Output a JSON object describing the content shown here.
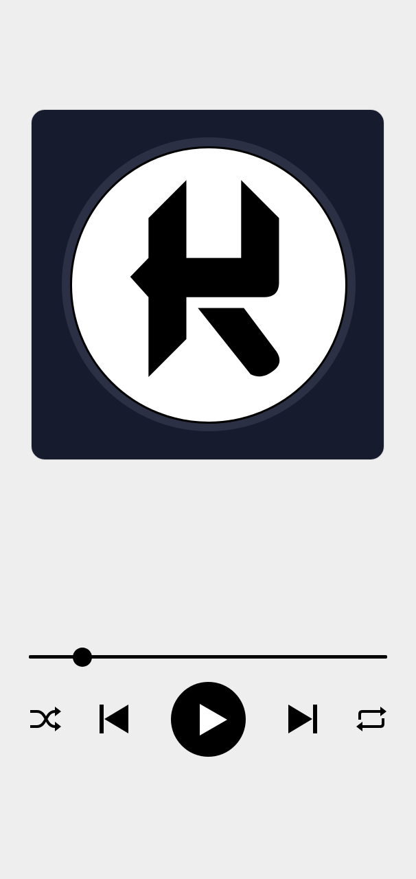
{
  "player": {
    "artwork": {
      "description_icon": "letter-r-logo",
      "background_color": "#171b2e",
      "disc_color": "#ffffff"
    },
    "progress": {
      "fraction": 0.15
    },
    "controls": {
      "shuffle_icon": "shuffle-icon",
      "previous_icon": "skip-previous-icon",
      "play_icon": "play-icon",
      "next_icon": "skip-next-icon",
      "repeat_icon": "repeat-icon"
    }
  }
}
